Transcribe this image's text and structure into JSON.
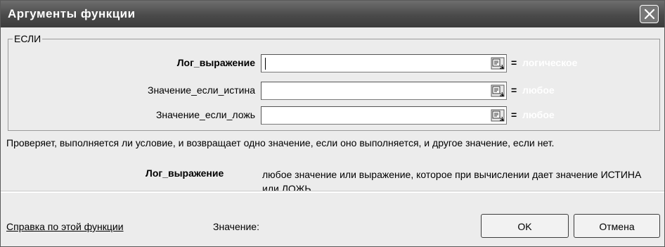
{
  "window": {
    "title": "Аргументы функции",
    "close_icon": "close-icon"
  },
  "function_group": {
    "name": "ЕСЛИ",
    "arguments": [
      {
        "label": "Лог_выражение",
        "value": "",
        "result": "логическое",
        "bold": true
      },
      {
        "label": "Значение_если_истина",
        "value": "",
        "result": "любое",
        "bold": false
      },
      {
        "label": "Значение_если_ложь",
        "value": "",
        "result": "любое",
        "bold": false
      }
    ],
    "equals_sign": "=",
    "collapse_icon": "collapse-dialog-icon"
  },
  "description": {
    "function_text": "Проверяет, выполняется ли условие, и возвращает одно значение, если оно выполняется, и другое значение, если нет.",
    "argument_name": "Лог_выражение",
    "argument_text": "любое значение или выражение, которое при вычислении дает значение ИСТИНА или ЛОЖЬ."
  },
  "footer": {
    "help_link": "Справка по этой функции",
    "value_label": "Значение:",
    "ok_label": "OK",
    "cancel_label": "Отмена"
  },
  "colors": {
    "title_bar": "#4a4a4a",
    "dialog_bg": "#ececec",
    "result_text": "#ffffff"
  }
}
